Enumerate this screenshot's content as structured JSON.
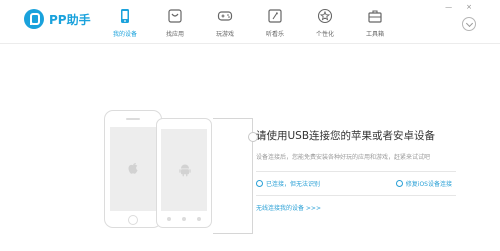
{
  "app": {
    "name": "PP助手"
  },
  "nav": [
    {
      "label": "我的设备",
      "icon": "phone-icon",
      "active": true
    },
    {
      "label": "找应用",
      "icon": "app-store-icon",
      "active": false
    },
    {
      "label": "玩游戏",
      "icon": "gamepad-icon",
      "active": false
    },
    {
      "label": "听看乐",
      "icon": "media-icon",
      "active": false
    },
    {
      "label": "个性化",
      "icon": "star-icon",
      "active": false
    },
    {
      "label": "工具箱",
      "icon": "toolbox-icon",
      "active": false
    }
  ],
  "window": {
    "minimize": "—",
    "close": "×"
  },
  "main": {
    "title": "请使用USB连接您的苹果或者安卓设备",
    "description": "设备连接后，您能免费安装各种好玩的应用和游戏，赶紧来试试吧",
    "help_left": "已连接，但无法识别",
    "help_right": "修复iOS设备连接",
    "try_link": "无线连接我的设备 >>>"
  },
  "colors": {
    "accent": "#1aa2dc"
  }
}
